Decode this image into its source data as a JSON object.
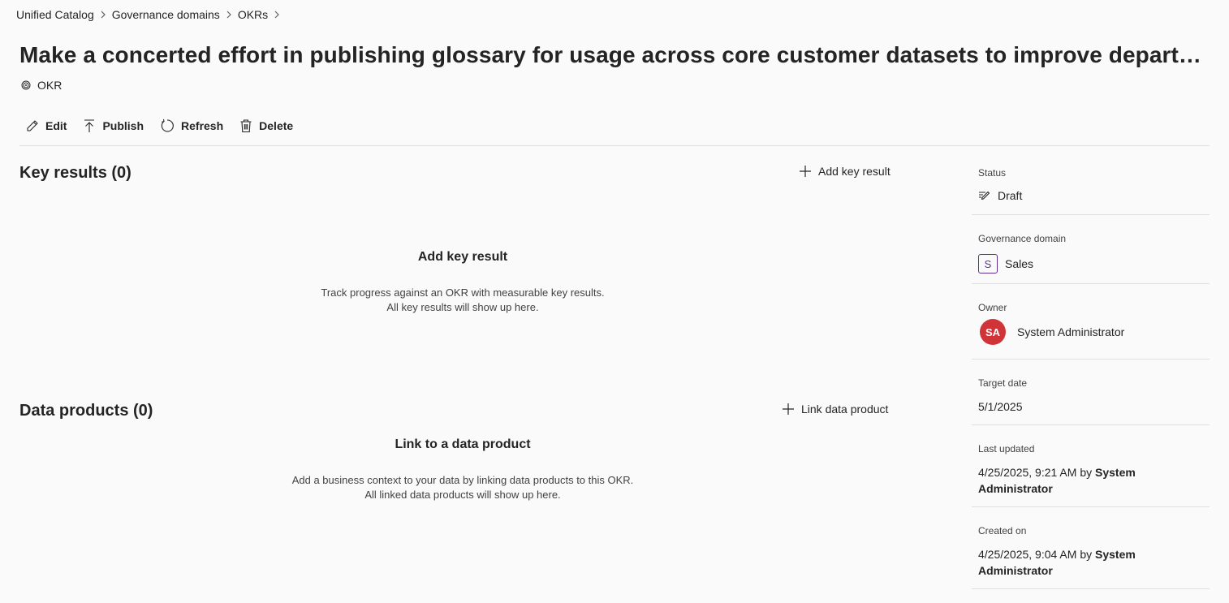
{
  "breadcrumb": [
    "Unified Catalog",
    "Governance domains",
    "OKRs"
  ],
  "title": "Make a concerted effort in publishing glossary for usage across core customer datasets to improve department w...",
  "type_tag": "OKR",
  "toolbar": {
    "edit": "Edit",
    "publish": "Publish",
    "refresh": "Refresh",
    "delete": "Delete"
  },
  "key_results": {
    "title": "Key results (0)",
    "add_label": "Add key result",
    "empty_title": "Add key result",
    "empty_line1": "Track progress against an OKR with measurable key results.",
    "empty_line2": "All key results will show up here."
  },
  "data_products": {
    "title": "Data products (0)",
    "add_label": "Link data product",
    "empty_title": "Link to a data product",
    "empty_line1": "Add a business context to your data by linking data products to this OKR.",
    "empty_line2": "All linked data products will show up here."
  },
  "sidebar": {
    "status": {
      "label": "Status",
      "value": "Draft"
    },
    "domain": {
      "label": "Governance domain",
      "badge": "S",
      "value": "Sales"
    },
    "owner": {
      "label": "Owner",
      "initials": "SA",
      "value": "System Administrator"
    },
    "target_date": {
      "label": "Target date",
      "value": "5/1/2025"
    },
    "last_updated": {
      "label": "Last updated",
      "date": "4/25/2025, 9:21 AM",
      "by": "by",
      "user": "System Administrator"
    },
    "created_on": {
      "label": "Created on",
      "date": "4/25/2025, 9:04 AM",
      "by": "by",
      "user": "System Administrator"
    }
  },
  "colors": {
    "background": "#fafafa",
    "text": "#242424",
    "avatar": "#d13438",
    "domain_badge": "#5c2e91",
    "divider": "#e0e0e0"
  }
}
